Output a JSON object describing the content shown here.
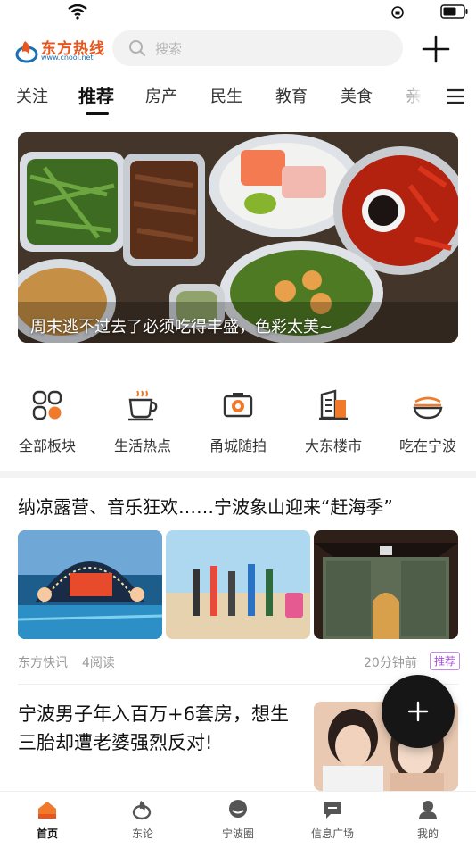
{
  "header": {
    "logo_text": "东方热线",
    "logo_sub": "www.cnool.net",
    "search_placeholder": "搜索"
  },
  "tabs": [
    {
      "label": "关注"
    },
    {
      "label": "推荐"
    },
    {
      "label": "房产"
    },
    {
      "label": "民生"
    },
    {
      "label": "教育"
    },
    {
      "label": "美食"
    },
    {
      "label": "亲"
    }
  ],
  "banner": {
    "caption": "周末逃不过去了必须吃得丰盛，色彩太美~"
  },
  "categories": [
    {
      "label": "全部板块",
      "icon": "grid-icon"
    },
    {
      "label": "生活热点",
      "icon": "coffee-cup-icon"
    },
    {
      "label": "甬城随拍",
      "icon": "camera-icon"
    },
    {
      "label": "大东楼市",
      "icon": "building-icon"
    },
    {
      "label": "吃在宁波",
      "icon": "noodle-bowl-icon"
    }
  ],
  "articles": [
    {
      "title": "纳凉露营、音乐狂欢……宁波象山迎来“赶海季”",
      "source": "东方快讯",
      "reads": "4阅读",
      "time": "20分钟前",
      "badge": "推荐"
    },
    {
      "title": "宁波男子年入百万+6套房，想生三胎却遭老婆强烈反对!"
    }
  ],
  "bottom_nav": [
    {
      "label": "首页",
      "icon": "home-icon"
    },
    {
      "label": "东论",
      "icon": "forum-icon"
    },
    {
      "label": "宁波圈",
      "icon": "chat-bubble-icon"
    },
    {
      "label": "信息广场",
      "icon": "message-board-icon"
    },
    {
      "label": "我的",
      "icon": "user-icon"
    }
  ],
  "colors": {
    "accent": "#e8561d",
    "active_nav": "#f07a2a",
    "badge": "#a74fd6"
  }
}
